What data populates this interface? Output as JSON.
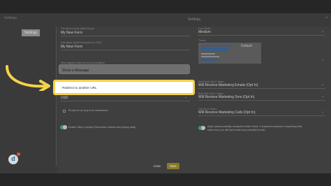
{
  "window": {
    "title": "Settings",
    "close_glyph": "×"
  },
  "dialog": {
    "title": "Settings"
  },
  "sidebar": {
    "items": [
      {
        "label": "Settings"
      }
    ]
  },
  "left_column": {
    "form_name_label": "The Name is only visible for you",
    "form_name_value": "My New Form",
    "description_label": "Description (Meta Description for SEO)",
    "description_value": "My New Form",
    "after_submit_label": "What happens after the form is submitted?",
    "after_submit_value": "Show a Message",
    "dropdown_option": "Redirect to another URL",
    "currency_value": "USD",
    "email_notify_label": "Email me on any form submission",
    "sticky_contact_label": "Enable Sticky Contact (Remember sidebar and prepop data)"
  },
  "right_column": {
    "form_width_label": "Form Width",
    "form_width_value": "Medium",
    "theme_label": "Theme",
    "default_label": "Default",
    "email_optin_label": "Bulk Email Opt-In Status",
    "email_optin_value": "Will Receive Marketing Emails (Opt In)",
    "sms_optin_label": "Bulk SMS Opt-In Status",
    "sms_optin_value": "Will Receive Marketing Sms (Opt In)",
    "calls_optin_label": "Call Opt-In Status",
    "calls_optin_value": "Will Receive Marketing Calls (Opt In)",
    "async_text_1": "Async (saves partially completed visitor forms. If customers abandon completing their",
    "async_text_2": "entire form you will have what they submitted so far)"
  },
  "footer": {
    "close_label": "Close",
    "save_label": "Save"
  },
  "avatar": {
    "letter": "d"
  },
  "colors": {
    "highlight": "#f5d24a",
    "arrow": "#f5d24a",
    "toggle_on": "#4a8f6b"
  },
  "icons": [
    "close-icon",
    "chevron-down-icon",
    "arrow-pointer-icon",
    "avatar-icon"
  ]
}
